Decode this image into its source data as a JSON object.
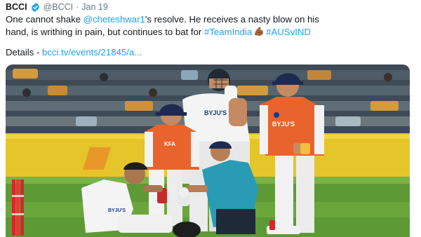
{
  "tweet": {
    "author_name": "BCCI",
    "handle": "@BCCI",
    "separator": "·",
    "date": "Jan 19",
    "text_part1": "One cannot shake ",
    "mention": "@cheteshwar1",
    "text_part2": "'s resolve. He receives a nasty blow on his",
    "text_line2": "hand, is writhing in pain, but continues to bat for ",
    "hashtag1": "#TeamIndia",
    "emoji": "flexed-biceps-emoji",
    "hashtag2": "#AUSvIND",
    "details_label": "Details - ",
    "details_link": "bcci.tv/events/21845/a...",
    "photo_text": {
      "kit_a": "BYJU'S",
      "kit_b": "BYJU'S",
      "kit_c": "KFA",
      "kit_d": "BYJU'S"
    }
  },
  "colors": {
    "link": "#1da1f2",
    "verified": "#1da1f2",
    "handle": "#657786",
    "orange_jersey": "#e8642c",
    "teal_shirt": "#2a9bb5",
    "outfield": "#5d9a35"
  }
}
